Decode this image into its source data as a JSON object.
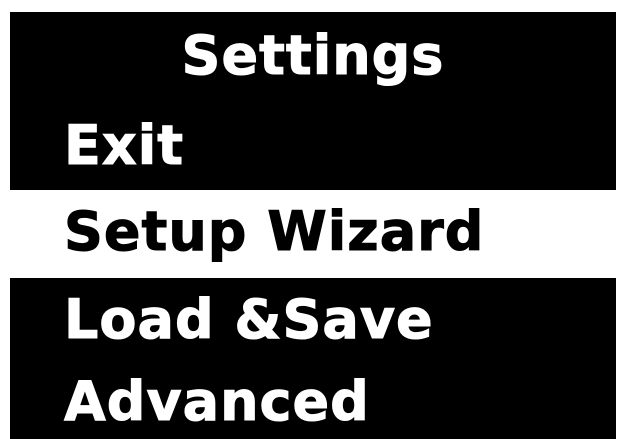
{
  "screen": {
    "title": "Settings",
    "selected_index": 1,
    "colors": {
      "background": "#000000",
      "text": "#ffffff",
      "selected_background": "#ffffff",
      "selected_text": "#000000"
    }
  },
  "menu": {
    "items": [
      {
        "label": "Exit"
      },
      {
        "label": "Setup Wizard"
      },
      {
        "label": "Load &Save"
      },
      {
        "label": "Advanced"
      }
    ]
  }
}
